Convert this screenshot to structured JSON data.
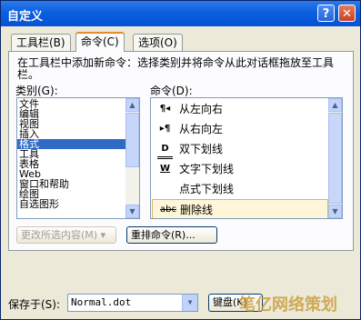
{
  "window": {
    "title": "自定义",
    "help_label": "?",
    "close_label": "✕"
  },
  "tabs": [
    {
      "label": "工具栏(B)"
    },
    {
      "label": "命令(C)"
    },
    {
      "label": "选项(O)"
    }
  ],
  "instruction": "在工具栏中添加新命令：选择类别并将命令从此对话框拖放至工具栏。",
  "categories": {
    "label": "类别(G):",
    "items": [
      "文件",
      "编辑",
      "视图",
      "插入",
      "格式",
      "工具",
      "表格",
      "Web",
      "窗口和帮助",
      "绘图",
      "自选图形"
    ],
    "selected": "格式"
  },
  "commands": {
    "label": "命令(D):",
    "items": [
      {
        "icon": "rtl-icon",
        "glyph": "¶◂",
        "label": "从左向右"
      },
      {
        "icon": "ltr-icon",
        "glyph": "▸¶",
        "label": "从右向左"
      },
      {
        "icon": "double-underline-icon",
        "glyph": "D",
        "label": "双下划线"
      },
      {
        "icon": "word-underline-icon",
        "glyph": "W",
        "label": "文字下划线"
      },
      {
        "icon": "dotted-underline-icon",
        "glyph": "",
        "label": "点式下划线"
      },
      {
        "icon": "strikethrough-icon",
        "glyph": "abc",
        "label": "删除线"
      }
    ],
    "selected": "删除线"
  },
  "buttons": {
    "modify_selection": "更改所选内容(M)",
    "rearrange": "重排命令(R)..."
  },
  "save_in": {
    "label": "保存于(S):",
    "value": "Normal.dot"
  },
  "keyboard_button": "键盘(K)",
  "watermark": "笔亿网络策划"
}
